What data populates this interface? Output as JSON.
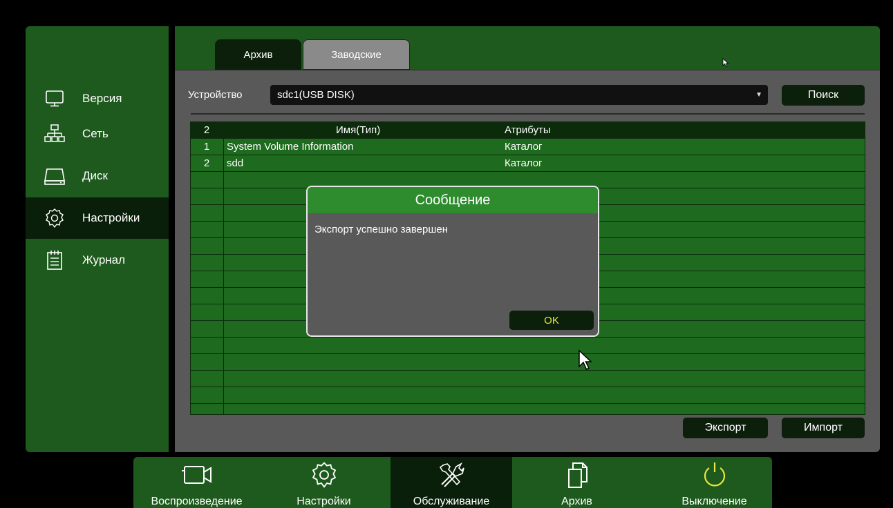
{
  "sidebar": {
    "items": [
      {
        "label": "Версия",
        "icon": "monitor-icon"
      },
      {
        "label": "Сеть",
        "icon": "network-icon"
      },
      {
        "label": "Диск",
        "icon": "disk-icon"
      },
      {
        "label": "Настройки",
        "icon": "gear-icon",
        "active": true
      },
      {
        "label": "Журнал",
        "icon": "log-icon"
      }
    ]
  },
  "tabs": [
    {
      "label": "Архив",
      "active": true
    },
    {
      "label": "Заводские",
      "active": false
    }
  ],
  "device": {
    "label": "Устройство",
    "value": "sdc1(USB DISK)",
    "search_label": "Поиск"
  },
  "table": {
    "header": {
      "count": "2",
      "name": "Имя(Тип)",
      "attr": "Атрибуты"
    },
    "rows": [
      {
        "idx": "1",
        "name": "System Volume Information",
        "attr": "Каталог"
      },
      {
        "idx": "2",
        "name": "sdd",
        "attr": "Каталог"
      }
    ]
  },
  "actions": {
    "export_label": "Экспорт",
    "import_label": "Импорт"
  },
  "dialog": {
    "title": "Сообщение",
    "message": "Экспорт успешно завершен",
    "ok_label": "OK"
  },
  "bottom_nav": {
    "items": [
      {
        "label": "Воспроизведение",
        "icon": "camera-icon"
      },
      {
        "label": "Настройки",
        "icon": "gear-icon"
      },
      {
        "label": "Обслуживание",
        "icon": "tools-icon",
        "active": true
      },
      {
        "label": "Архив",
        "icon": "copy-icon"
      },
      {
        "label": "Выключение",
        "icon": "power-icon"
      }
    ]
  },
  "colors": {
    "panel_green": "#1e5a1e",
    "table_green": "#1e6a1e",
    "dialog_title": "#2e8b2e",
    "dark_button": "#0b1f0b",
    "ok_text": "#e8e840"
  }
}
